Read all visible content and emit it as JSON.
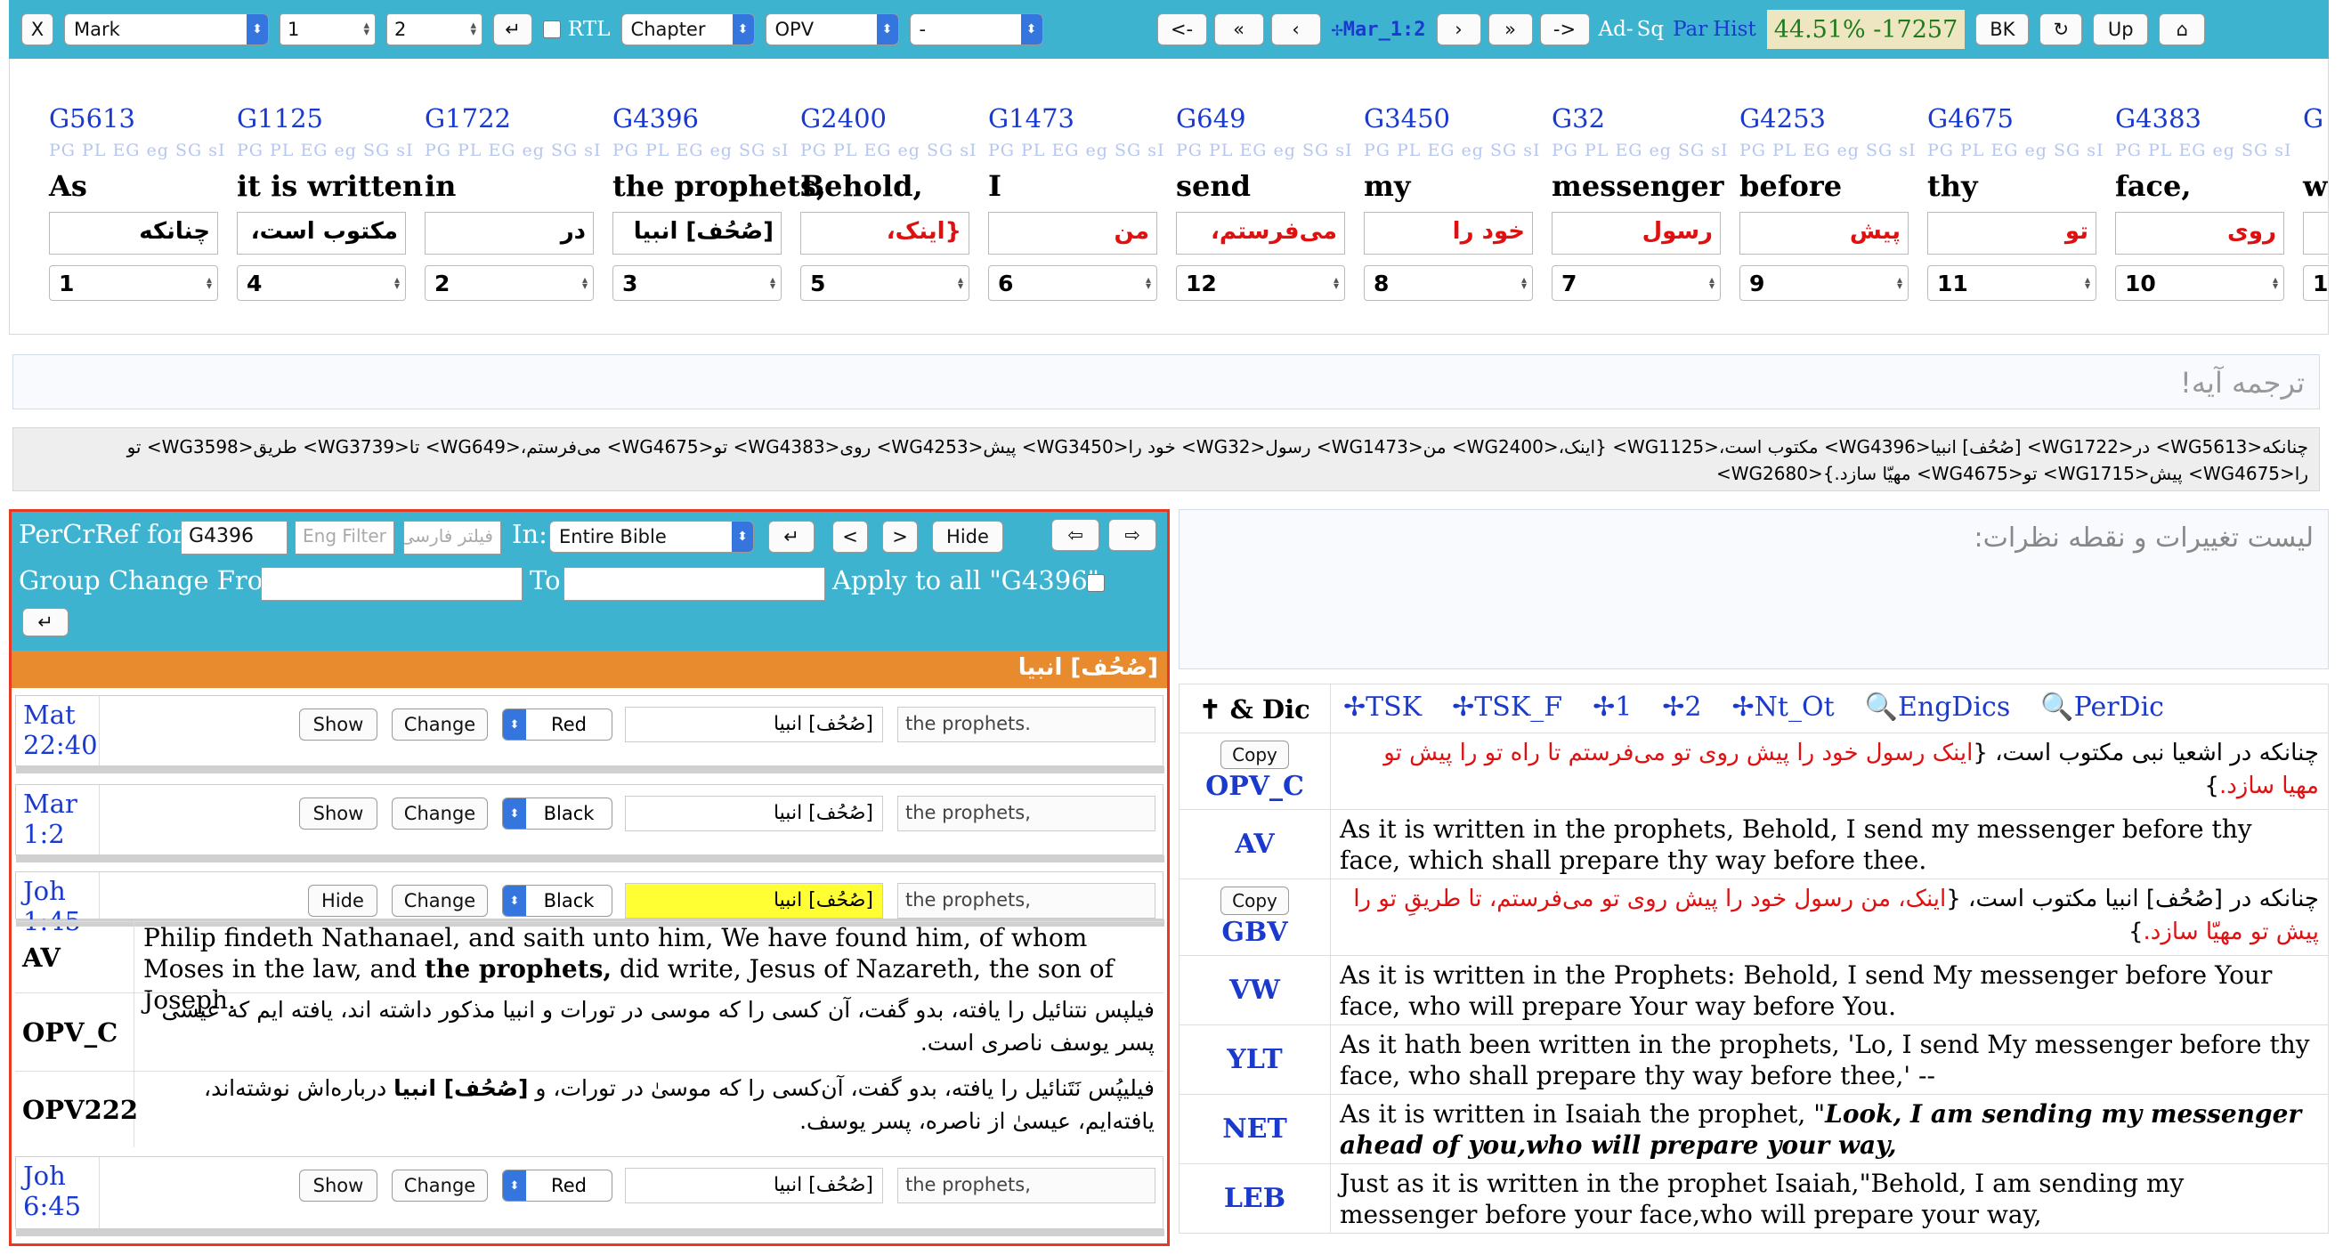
{
  "toolbar": {
    "close_label": "X",
    "book": "Mark",
    "chapter": "1",
    "verse": "2",
    "enter_label": "↵",
    "rtl_label": "RTL",
    "mode": "Chapter",
    "version": "OPV",
    "extra": "-",
    "prev_chapter_label": "<-",
    "first_label": "«",
    "prev_label": "‹",
    "reference": "✢Mar_1:2",
    "next_label": "›",
    "last_label": "»",
    "next_chapter_label": "->",
    "ad_label": "Ad-",
    "sq_label": "Sq",
    "par_label": "Par",
    "hist_label": "Hist",
    "progress": "44.51% -17257",
    "bk_label": "BK",
    "refresh_label": "↻",
    "up_label": "Up",
    "home_label": "⌂"
  },
  "words": [
    {
      "strong": "G5613",
      "meta": "PG PL EG eg SG sI",
      "eng": "As",
      "per": "چنانکه",
      "red": false,
      "order": "1"
    },
    {
      "strong": "G1125",
      "meta": "PG PL EG eg SG sI",
      "eng": "it is written",
      "per": "مکتوب است،",
      "red": false,
      "order": "4"
    },
    {
      "strong": "G1722",
      "meta": "PG PL EG eg SG sI",
      "eng": "in",
      "per": "در",
      "red": false,
      "order": "2"
    },
    {
      "strong": "G4396",
      "meta": "PG PL EG eg SG sI",
      "eng": "the prophets,",
      "per": "[صُحُف] انبیا",
      "red": false,
      "order": "3"
    },
    {
      "strong": "G2400",
      "meta": "PG PL EG eg SG sI",
      "eng": "Behold,",
      "per": "{اینک،",
      "red": true,
      "order": "5"
    },
    {
      "strong": "G1473",
      "meta": "PG PL EG eg SG sI",
      "eng": "I",
      "per": "من",
      "red": true,
      "order": "6"
    },
    {
      "strong": "G649",
      "meta": "PG PL EG eg SG sI",
      "eng": "send",
      "per": "می‌فرستم،",
      "red": true,
      "order": "12"
    },
    {
      "strong": "G3450",
      "meta": "PG PL EG eg SG sI",
      "eng": "my",
      "per": "خود را",
      "red": true,
      "order": "8"
    },
    {
      "strong": "G32",
      "meta": "PG PL EG eg SG sI",
      "eng": "messenger",
      "per": "رسول",
      "red": true,
      "order": "7"
    },
    {
      "strong": "G4253",
      "meta": "PG PL EG eg SG sI",
      "eng": "before",
      "per": "پیش",
      "red": true,
      "order": "9"
    },
    {
      "strong": "G4675",
      "meta": "PG PL EG eg SG sI",
      "eng": "thy",
      "per": "تو",
      "red": true,
      "order": "11"
    },
    {
      "strong": "G4383",
      "meta": "PG PL EG eg SG sI",
      "eng": "face,",
      "per": "روی",
      "red": true,
      "order": "10"
    },
    {
      "strong": "G",
      "meta": "",
      "eng": "w",
      "per": "",
      "red": true,
      "order": "1"
    }
  ],
  "translation_placeholder": "ترجمه آیه!",
  "tagged_text": "چنانکه<WG5613> در<WG1722> [صُحُف] انبیا<WG4396> مکتوب است،<WG1125> {اینک،<WG2400> من<WG1473> رسول<WG32> خود را<WG3450> پیش<WG4253> روی<WG4383> تو<WG4675> می‌فرستم،<WG649> تا<WG3739> طریق<WG3598> تو را<WG4675> پیش<WG1715> تو<WG4675> مهیّا سازد.}<WG2680>",
  "percref": {
    "label": "PerCrRef for:",
    "strong": "G4396",
    "eng_filter_placeholder": "Eng Filter",
    "per_filter_placeholder": "فیلتر فارسی",
    "in_label": "In:",
    "scope": "Entire Bible",
    "enter_label": "↵",
    "prev_label": "<",
    "next_label": ">",
    "hide_label": "Hide",
    "back_label": "⇦",
    "fwd_label": "⇨",
    "group_from_label": "Group Change From",
    "to_label": "To",
    "apply_label": "Apply to all \"G4396\"",
    "apply_enter_label": "↵",
    "heading": "[صُحُف] انبیا",
    "show_label": "Show",
    "change_label": "Change",
    "rows": [
      {
        "ref": "Mat 22:40",
        "toggle": "Show",
        "color": "Red",
        "per": "[صُحُف] انبیا",
        "eng": "the prophets."
      },
      {
        "ref": "Mar 1:2",
        "toggle": "Show",
        "color": "Black",
        "per": "[صُحُف] انبیا",
        "eng": "the prophets,"
      },
      {
        "ref": "Joh 1:45",
        "toggle": "Hide",
        "color": "Black",
        "per": "[صُحُف] انبیا",
        "eng": "the prophets,"
      },
      {
        "ref": "Joh 6:45",
        "toggle": "Show",
        "color": "Red",
        "per": "[صُحُف] انبیا",
        "eng": "the prophets,"
      }
    ],
    "expanded": {
      "av_label": "AV",
      "av_a": "Philip findeth Nathanael, and saith unto him, We have found him, of whom Moses in the law, and ",
      "av_b": "the prophets,",
      "av_c": " did write, Jesus of Nazareth, the son of Joseph.",
      "opvc_label": "OPV_C",
      "opvc_text": "فیلپس نتنائیل را یافته، بدو گفت، آن کسی را که موسی در تورات و انبیا مذکور داشته اند، یافته ایم که عیسی پسر یوسف ناصری است.",
      "opv222_label": "OPV222",
      "opv222_a": "فیلیپُس نَتَنائیل را یافته، بدو گفت، آن‌کسی را که موسیٰ در تورات، و ",
      "opv222_b": "[صُحُف] انبیا",
      "opv222_c": " درباره‌اش نوشته‌اند، یافته‌ایم، عیسیٰ از ناصره، پسر یوسف."
    }
  },
  "notes_placeholder": "لیست تغییرات و نقطه نظرات:",
  "versions": {
    "head_label": "✝ & Dic",
    "links": [
      "✢TSK",
      "✢TSK_F",
      "✢1",
      "✢2",
      "✢Nt_Ot",
      "🔍EngDics",
      "🔍PerDic"
    ],
    "copy_label": "Copy",
    "opvc_label": "OPV_C",
    "opvc_a": "چنانکه در اشعیا نبی مکتوب است، {",
    "opvc_b": "اینک رسول خود را پیش روی تو می‌فرستم تا راه تو را پیش تو مهیا سازد.",
    "opvc_c": "}",
    "av_label": "AV",
    "av_text": "As it is written in the prophets, Behold, I send my messenger before thy face, which shall prepare thy way before thee.",
    "gbv_label": "GBV",
    "gbv_a": "چنانکه در [صُحُف] انبیا مکتوب است، {",
    "gbv_b": "اینک، من رسول خود را پیش روی تو می‌فرستم، تا طریقِ تو را پیش تو مهیّا سازد.",
    "gbv_c": "}",
    "vw_label": "VW",
    "vw_text": "As it is written in the Prophets: Behold, I send My messenger before Your face, who will prepare Your way before You.",
    "ylt_label": "YLT",
    "ylt_text": "As it hath been written in the prophets, 'Lo, I send My messenger before thy face, who shall prepare thy way before thee,' --",
    "net_label": "NET",
    "net_a": "As it is written in Isaiah the prophet, \"",
    "net_b": "Look, I am sending my messenger ahead of you,who will prepare your way,",
    "leb_label": "LEB",
    "leb_text": "Just as it is written in the prophet Isaiah,\"Behold, I am sending my messenger before your face,who will prepare your way,"
  }
}
